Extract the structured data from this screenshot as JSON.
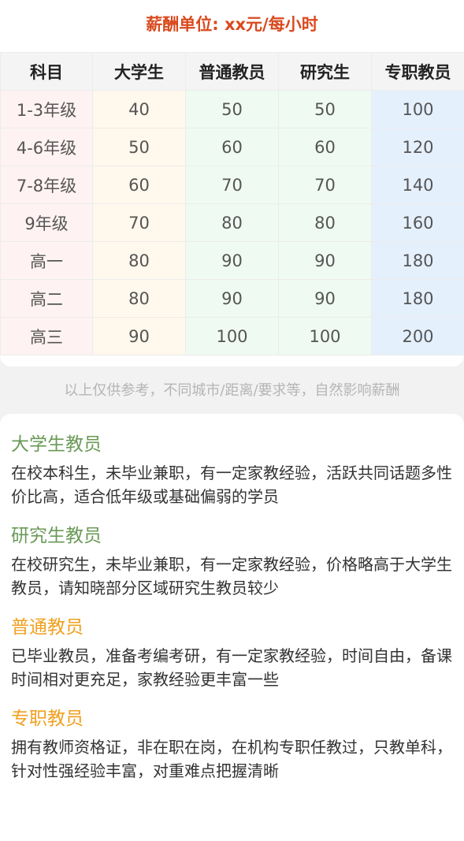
{
  "title": "薪酬单位: xx元/每小时",
  "table": {
    "headers": [
      "科目",
      "大学生",
      "普通教员",
      "研究生",
      "专职教员"
    ],
    "rows": [
      [
        "1-3年级",
        "40",
        "50",
        "50",
        "100"
      ],
      [
        "4-6年级",
        "50",
        "60",
        "60",
        "120"
      ],
      [
        "7-8年级",
        "60",
        "70",
        "70",
        "140"
      ],
      [
        "9年级",
        "70",
        "80",
        "80",
        "160"
      ],
      [
        "高一",
        "80",
        "90",
        "90",
        "180"
      ],
      [
        "高二",
        "80",
        "90",
        "90",
        "180"
      ],
      [
        "高三",
        "90",
        "100",
        "100",
        "200"
      ]
    ]
  },
  "note": "以上仅供参考，不同城市/距离/要求等，自然影响薪酬",
  "sections": [
    {
      "title": "大学生教员",
      "desc": "在校本科生，未毕业兼职，有一定家教经验，活跃共同话题多性价比高，适合低年级或基础偏弱的学员"
    },
    {
      "title": "研究生教员",
      "desc": "在校研究生，未毕业兼职，有一定家教经验，价格略高于大学生教员，请知晓部分区域研究生教员较少"
    },
    {
      "title": "普通教员",
      "desc": "已毕业教员，准备考编考研，有一定家教经验，时间自由，备课时间相对更充足，家教经验更丰富一些"
    },
    {
      "title": "专职教员",
      "desc": "拥有教师资格证，非在职在岗，在机构专职任教过，只教单科，针对性强经验丰富，对重难点把握清晰"
    }
  ],
  "colors": {
    "title": "#d94a1e",
    "section_green": "#6a9a57",
    "section_orange": "#f0a020",
    "note": "#b5b5b5"
  }
}
